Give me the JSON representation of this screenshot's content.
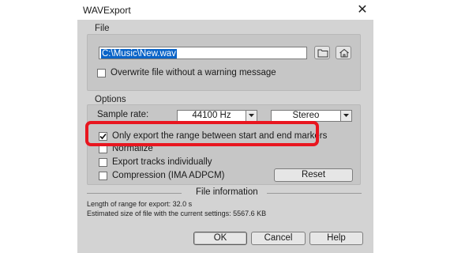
{
  "window": {
    "title": "WAVExport",
    "close_glyph": "✕"
  },
  "file_group": {
    "title": "File",
    "path_value": "C:\\Music\\New.wav",
    "folder_button_icon": "folder-icon",
    "home_button_icon": "home-icon",
    "overwrite_label": "Overwrite file without a warning message",
    "overwrite_checked": false
  },
  "options_group": {
    "title": "Options",
    "sample_rate_label": "Sample rate:",
    "sample_rate_value": "44100 Hz",
    "channels_value": "Stereo",
    "only_range_label": "Only export the range between start and end markers",
    "only_range_checked": true,
    "normalize_label": "Normalize",
    "normalize_checked": false,
    "export_tracks_label": "Export tracks individually",
    "export_tracks_checked": false,
    "compression_label": "Compression (IMA ADPCM)",
    "compression_checked": false,
    "reset_label": "Reset"
  },
  "file_info": {
    "title": "File information",
    "length_text": "Length of range for export: 32.0 s",
    "size_text": "Estimated size of file with the current settings: 5567.6 KB"
  },
  "buttons": {
    "ok": "OK",
    "cancel": "Cancel",
    "help": "Help"
  },
  "colors": {
    "highlight": "#e8161f",
    "selection": "#0a64c8"
  }
}
